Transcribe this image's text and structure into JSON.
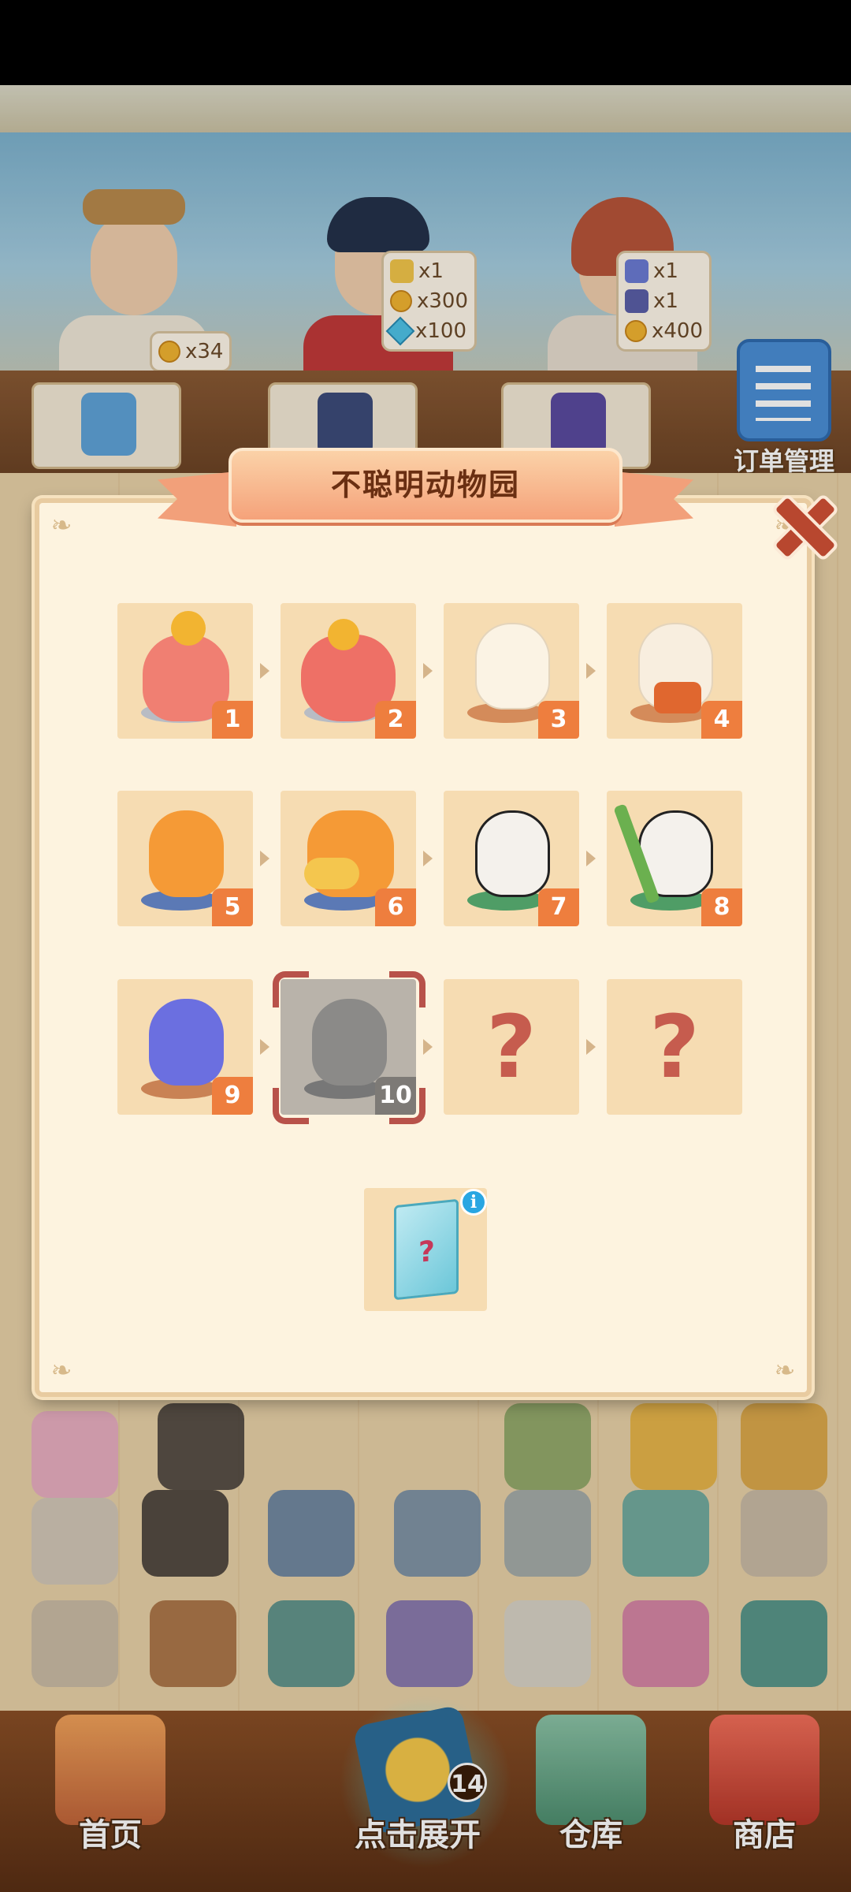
{
  "game": {
    "order_panel_label": "订单管理",
    "customers": [
      {
        "name": "customer-1",
        "rewards": [
          {
            "icon": "paw-coin-icon",
            "amount": "x34"
          }
        ]
      },
      {
        "name": "customer-2",
        "rewards": [
          {
            "icon": "item-icon",
            "amount": "x1"
          },
          {
            "icon": "paw-coin-icon",
            "amount": "x300"
          },
          {
            "icon": "gem-icon",
            "amount": "x100"
          }
        ]
      },
      {
        "name": "customer-3",
        "rewards": [
          {
            "icon": "item-icon",
            "amount": "x1"
          },
          {
            "icon": "item-icon",
            "amount": "x1"
          },
          {
            "icon": "paw-coin-icon",
            "amount": "x400"
          }
        ]
      }
    ]
  },
  "modal": {
    "title": "不聪明动物园",
    "items": [
      {
        "level": "1",
        "label": "piggy-bank-figurine",
        "color": "#f07f72",
        "base": "#b8bcc4",
        "locked": false,
        "unknown": false
      },
      {
        "level": "2",
        "label": "piggy-bank-figurine-2",
        "color": "#ee7066",
        "base": "#b8bcc4",
        "locked": false,
        "unknown": false
      },
      {
        "level": "3",
        "label": "alpaca-figurine",
        "color": "#fbf3e4",
        "base": "#d48b5a",
        "locked": false,
        "unknown": false
      },
      {
        "level": "4",
        "label": "alpaca-knitting-figurine",
        "color": "#f8eedf",
        "base": "#d48b5a",
        "locked": false,
        "unknown": false
      },
      {
        "level": "5",
        "label": "orange-hippo-figurine",
        "color": "#f59a36",
        "base": "#5b79b5",
        "locked": false,
        "unknown": false
      },
      {
        "level": "6",
        "label": "orange-hippo-swim-figurine",
        "color": "#f59a36",
        "base": "#5b79b5",
        "locked": false,
        "unknown": false
      },
      {
        "level": "7",
        "label": "panda-figurine",
        "color": "#f4f1ec",
        "base": "#4f9d66",
        "locked": false,
        "unknown": false
      },
      {
        "level": "8",
        "label": "panda-bamboo-figurine",
        "color": "#f4f1ec",
        "base": "#4f9d66",
        "locked": false,
        "unknown": false
      },
      {
        "level": "9",
        "label": "blue-bear-figurine",
        "color": "#6b6fe0",
        "base": "#c98254",
        "locked": false,
        "unknown": false
      },
      {
        "level": "10",
        "label": "koala-figurine-locked",
        "color": "#8b8a88",
        "base": "#777",
        "locked": true,
        "unknown": false
      },
      {
        "level": "",
        "label": "?",
        "color": "",
        "base": "",
        "locked": false,
        "unknown": true
      },
      {
        "level": "",
        "label": "?",
        "color": "",
        "base": "",
        "locked": false,
        "unknown": true
      }
    ],
    "blind_box_info": "i",
    "blind_box_mark": "?"
  },
  "nav": {
    "home": "首页",
    "open": "点击展开",
    "open_badge": "14",
    "storage": "仓库",
    "shop": "商店"
  },
  "colors": {
    "accent": "#ee7e3e",
    "modal_bg": "#fdf3df",
    "cell_bg": "#f6dcb2",
    "question": "#c65c4e"
  }
}
